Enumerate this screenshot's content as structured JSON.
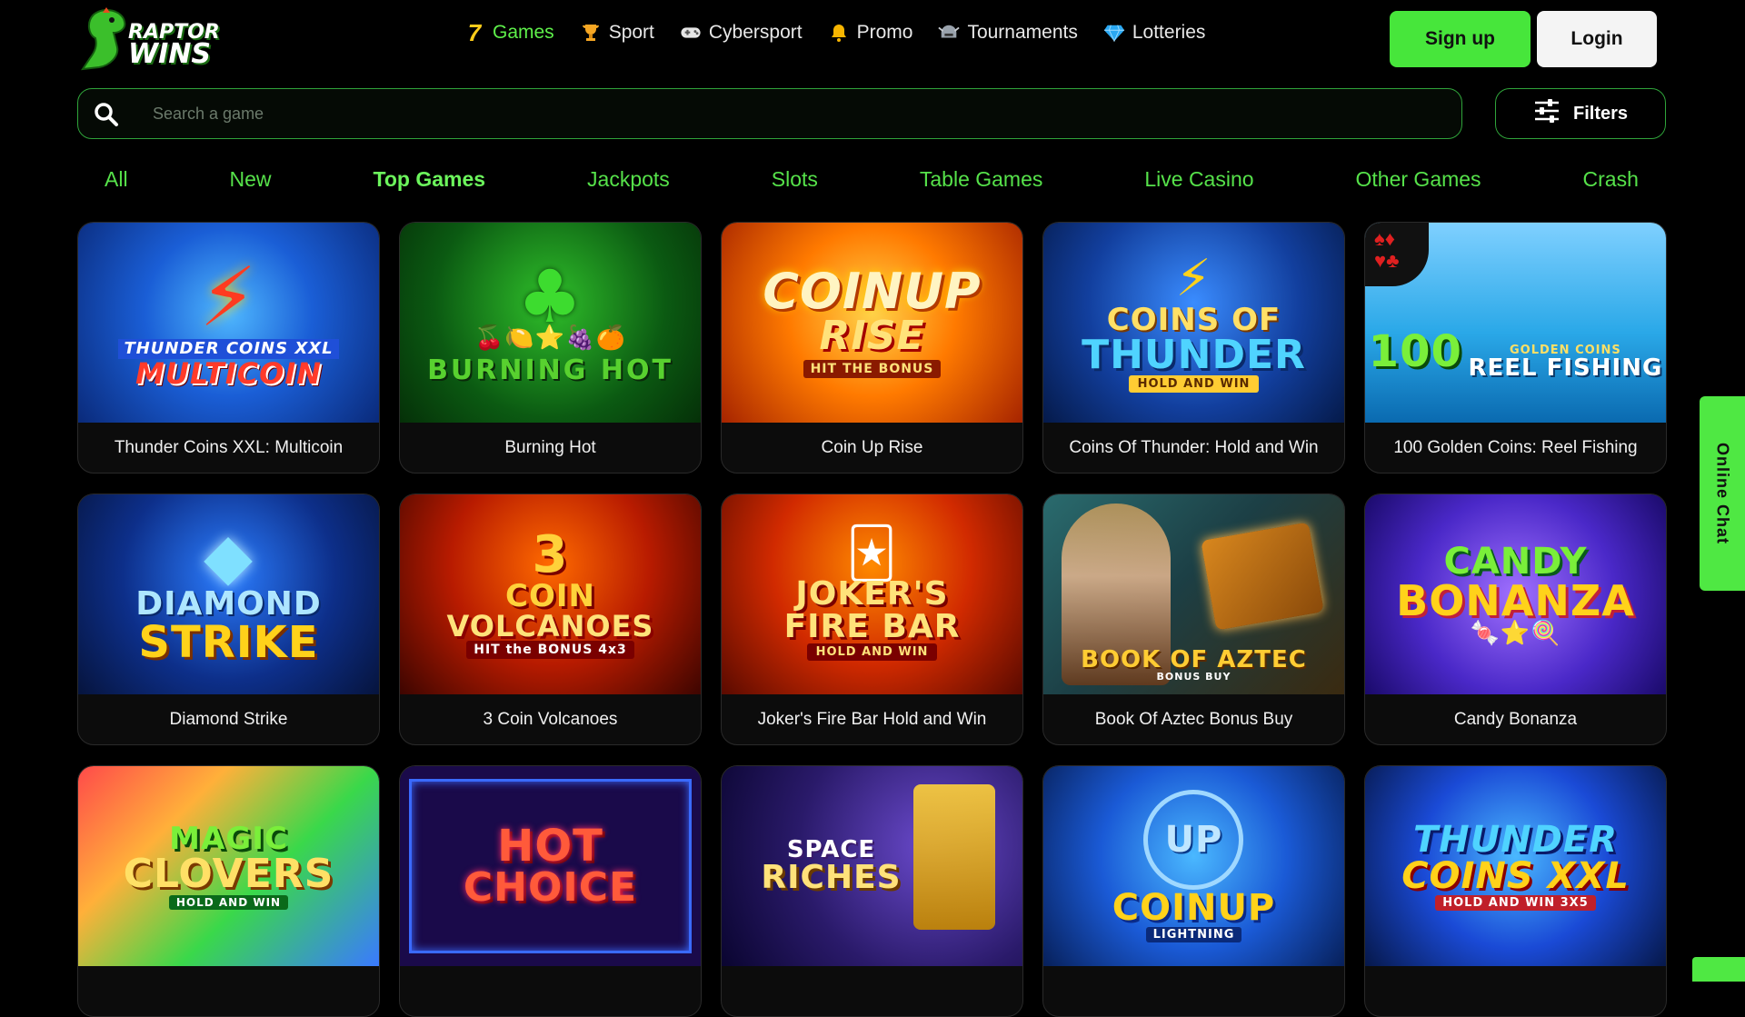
{
  "logo": {
    "line1": "RAPTOR",
    "line2": "WINS"
  },
  "nav": [
    {
      "label": "Games",
      "icon": "seven-icon",
      "glyph": "7"
    },
    {
      "label": "Sport",
      "icon": "trophy-icon",
      "glyph": "🏆"
    },
    {
      "label": "Cybersport",
      "icon": "gamepad-icon",
      "glyph": "🎮"
    },
    {
      "label": "Promo",
      "icon": "bell-icon",
      "glyph": "🔔"
    },
    {
      "label": "Tournaments",
      "icon": "helmet-icon",
      "glyph": "⚔"
    },
    {
      "label": "Lotteries",
      "icon": "diamond-icon",
      "glyph": "💎"
    }
  ],
  "auth": {
    "signup": "Sign up",
    "login": "Login"
  },
  "search": {
    "placeholder": "Search a game"
  },
  "filters": {
    "label": "Filters"
  },
  "categories": [
    "All",
    "New",
    "Top Games",
    "Jackpots",
    "Slots",
    "Table Games",
    "Live Casino",
    "Other Games",
    "Crash"
  ],
  "active_category": "Top Games",
  "games": [
    {
      "title": "Thunder Coins XXL: Multicoin"
    },
    {
      "title": "Burning Hot"
    },
    {
      "title": "Coin Up Rise"
    },
    {
      "title": "Coins Of Thunder: Hold and Win"
    },
    {
      "title": "100 Golden Coins: Reel Fishing"
    },
    {
      "title": "Diamond Strike"
    },
    {
      "title": "3 Coin Volcanoes"
    },
    {
      "title": "Joker's Fire Bar Hold and Win"
    },
    {
      "title": "Book Of Aztec Bonus Buy"
    },
    {
      "title": "Candy Bonanza"
    },
    {
      "title": ""
    },
    {
      "title": ""
    },
    {
      "title": ""
    },
    {
      "title": ""
    },
    {
      "title": ""
    }
  ],
  "art": {
    "g1": {
      "a": "THUNDER COINS XXL",
      "b": "MULTICOIN"
    },
    "g2": {
      "a": "BURNING HOT"
    },
    "g3": {
      "a": "COINUP",
      "b": "RISE",
      "c": "HIT THE BONUS"
    },
    "g4": {
      "a": "COINS OF",
      "b": "THUNDER",
      "c": "HOLD AND WIN"
    },
    "g5": {
      "a": "100",
      "b": "GOLDEN COINS",
      "c": "REEL FISHING"
    },
    "g6": {
      "a": "DIAMOND",
      "b": "STRIKE"
    },
    "g7": {
      "a": "3",
      "b": "COIN",
      "c": "VOLCANOES",
      "d": "HIT the BONUS 4x3"
    },
    "g8": {
      "a": "JOKER'S",
      "b": "FIRE BAR",
      "c": "HOLD AND WIN"
    },
    "g9": {
      "a": "BOOK OF AZTEC",
      "b": "BONUS BUY"
    },
    "g10": {
      "a": "CANDY",
      "b": "BONANZA"
    },
    "g11": {
      "a": "MAGIC",
      "b": "CLOVERS",
      "c": "HOLD AND WIN"
    },
    "g12": {
      "a": "HOT",
      "b": "CHOICE"
    },
    "g13": {
      "a": "SPACE",
      "b": "RICHES"
    },
    "g14": {
      "a": "UP",
      "b": "COINUP",
      "c": "LIGHTNING"
    },
    "g15": {
      "a": "THUNDER",
      "b": "COINS XXL",
      "c": "HOLD AND WIN 3X5"
    }
  },
  "chat": {
    "label": "Online Chat"
  },
  "colors": {
    "accent": "#47e63b",
    "background": "#000000"
  }
}
